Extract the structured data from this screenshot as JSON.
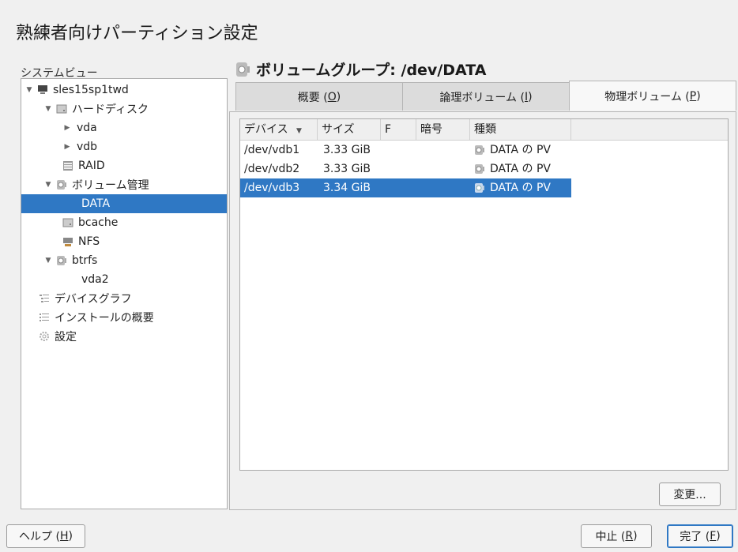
{
  "window": {
    "title": "熟練者向けパーティション設定"
  },
  "sidebar": {
    "label": "システムビュー",
    "items": [
      {
        "label": "sles15sp1twd",
        "icon": "computer-icon",
        "arrow": "▼"
      },
      {
        "label": "ハードディスク",
        "icon": "harddisk-icon",
        "arrow": "▼"
      },
      {
        "label": "vda",
        "icon": "",
        "arrow": "▶"
      },
      {
        "label": "vdb",
        "icon": "",
        "arrow": "▶"
      },
      {
        "label": "RAID",
        "icon": "raid-icon",
        "arrow": ""
      },
      {
        "label": "ボリューム管理",
        "icon": "volume-icon",
        "arrow": "▼"
      },
      {
        "label": "DATA",
        "icon": "",
        "arrow": ""
      },
      {
        "label": "bcache",
        "icon": "bcache-icon",
        "arrow": ""
      },
      {
        "label": "NFS",
        "icon": "nfs-icon",
        "arrow": ""
      },
      {
        "label": "btrfs",
        "icon": "btrfs-icon",
        "arrow": "▼"
      },
      {
        "label": "vda2",
        "icon": "",
        "arrow": ""
      },
      {
        "label": "デバイスグラフ",
        "icon": "device-graph-icon",
        "arrow": ""
      },
      {
        "label": "インストールの概要",
        "icon": "install-summary-icon",
        "arrow": ""
      },
      {
        "label": "設定",
        "icon": "settings-gear-icon",
        "arrow": ""
      }
    ],
    "selected_index": 6
  },
  "main": {
    "header": "ボリュームグループ: /dev/DATA",
    "tabs": [
      {
        "label": "概要 (",
        "key": "O",
        "suffix": ")"
      },
      {
        "label": "論理ボリューム (",
        "key": "I",
        "suffix": ")"
      },
      {
        "label": "物理ボリューム (",
        "key": "P",
        "suffix": ")"
      }
    ],
    "active_tab": 2,
    "table": {
      "columns": [
        "デバイス",
        "サイズ",
        "F",
        "暗号",
        "種類"
      ],
      "sort_indicator": "▼",
      "rows": [
        {
          "device": "/dev/vdb1",
          "size": "3.33 GiB",
          "f": "",
          "enc": "",
          "type": "DATA の PV"
        },
        {
          "device": "/dev/vdb2",
          "size": "3.33 GiB",
          "f": "",
          "enc": "",
          "type": "DATA の PV"
        },
        {
          "device": "/dev/vdb3",
          "size": "3.34 GiB",
          "f": "",
          "enc": "",
          "type": "DATA の PV"
        }
      ],
      "selected_row": 2
    },
    "modify_button": "変更..."
  },
  "footer": {
    "help": {
      "label": "ヘルプ (",
      "key": "H",
      "suffix": ")"
    },
    "abort": {
      "label": "中止 (",
      "key": "R",
      "suffix": ")"
    },
    "finish": {
      "label": "完了 (",
      "key": "F",
      "suffix": ")"
    }
  },
  "colors": {
    "selection": "#2f78c4",
    "background": "#f0f0f0"
  }
}
